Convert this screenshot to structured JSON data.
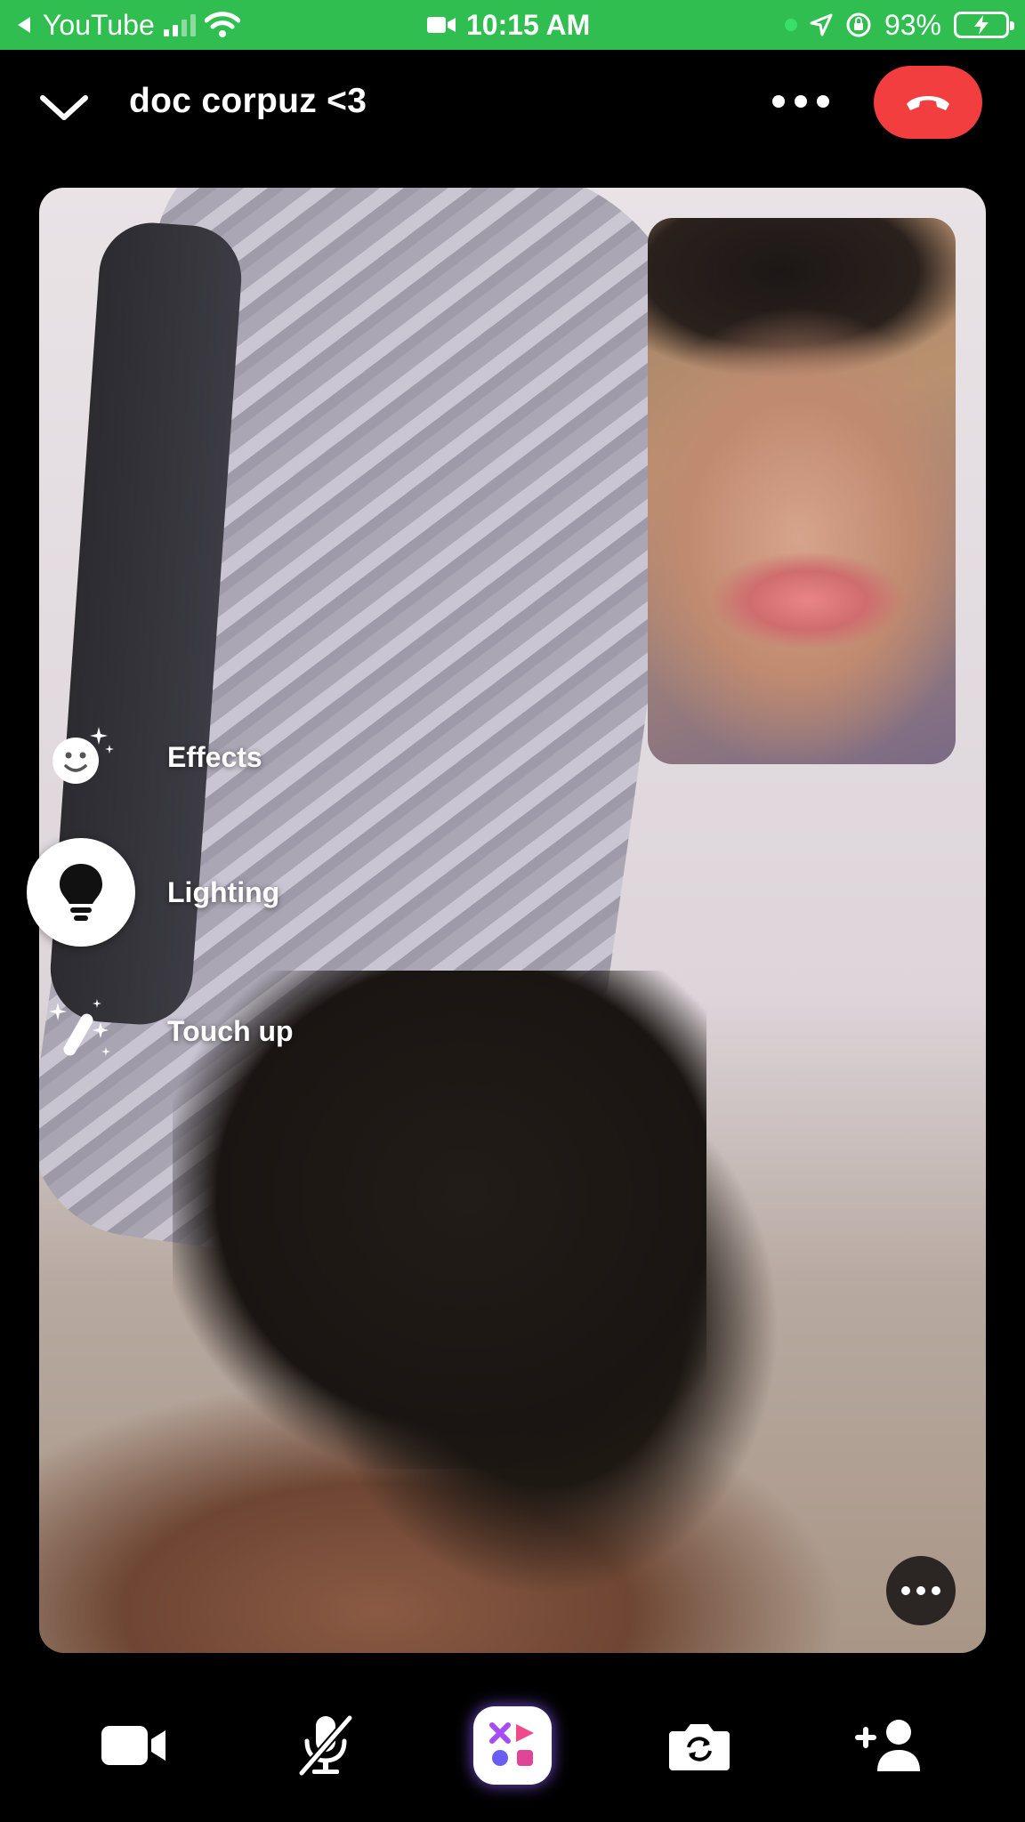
{
  "status_bar": {
    "back_app": "YouTube",
    "time": "10:15 AM",
    "battery": "93%",
    "icons": [
      "back-arrow-icon",
      "cellular-signal-icon",
      "wifi-icon",
      "video-camera-icon",
      "location-arrow-icon",
      "rotation-lock-icon",
      "battery-charging-icon"
    ],
    "color": "#2fbe4f"
  },
  "header": {
    "title": "doc corpuz <3",
    "icons": [
      "chevron-down-icon",
      "more-icon",
      "end-call-icon"
    ],
    "end_call_color": "#f33e40"
  },
  "effects_menu": {
    "items": [
      {
        "label": "Effects",
        "icon": "smiley-sparkle-icon",
        "active": false
      },
      {
        "label": "Lighting",
        "icon": "lightbulb-icon",
        "active": true
      },
      {
        "label": "Touch up",
        "icon": "magic-wand-icon",
        "active": false
      }
    ]
  },
  "toolbar": {
    "buttons": [
      "video-camera-icon",
      "microphone-muted-icon",
      "apps-icon",
      "flip-camera-icon",
      "add-person-icon"
    ]
  }
}
